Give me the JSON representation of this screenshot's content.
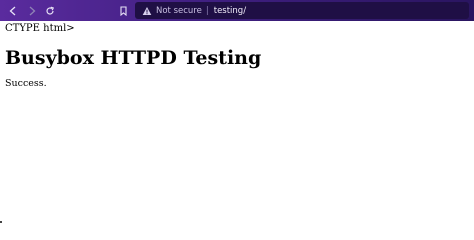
{
  "browser": {
    "security_label": "Not secure",
    "separator": "|",
    "url": "testing/",
    "colors": {
      "toolbar_gradient_start": "#5a2b9e",
      "toolbar_gradient_end": "#2a1560",
      "address_bar": "#1f0f45"
    },
    "icons": [
      "back-arrow-icon",
      "forward-arrow-icon",
      "reload-icon",
      "bookmark-icon",
      "warning-triangle-icon"
    ]
  },
  "page": {
    "doctype_fragment": "CTYPE html>",
    "heading": "Busybox HTTPD Testing",
    "status": "Success."
  }
}
